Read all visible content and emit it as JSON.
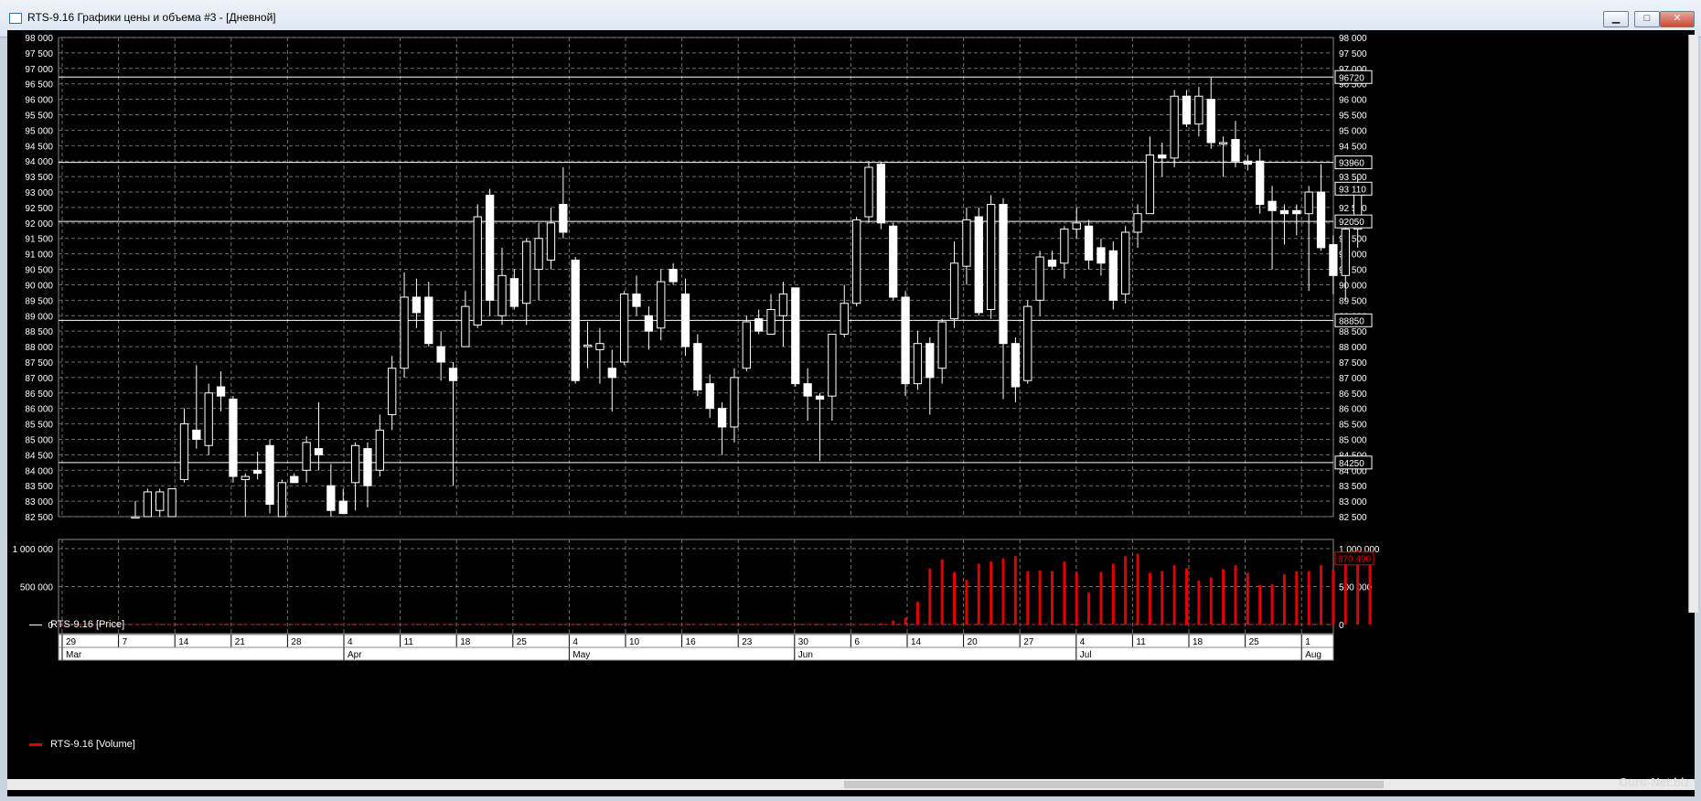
{
  "window": {
    "title": "RTS-9.16 Графики цены и объема #3 - [Дневной]",
    "minimize": "▁",
    "maximize": "□",
    "close": "✕"
  },
  "colors": {
    "background": "#000000",
    "grid": "#6f6f6f",
    "axis_text": "#ffffff",
    "volume_bar": "#e00000",
    "level_line": "#ffffff"
  },
  "price_panel": {
    "legend": "RTS-9.16 [Price]",
    "y_ticks": [
      "98 000",
      "97 500",
      "97 000",
      "96 500",
      "96 000",
      "95 500",
      "95 000",
      "94 500",
      "94 000",
      "93 500",
      "93 000",
      "92 500",
      "92 000",
      "91 500",
      "91 000",
      "90 500",
      "90 000",
      "89 500",
      "89 000",
      "88 500",
      "88 000",
      "87 500",
      "87 000",
      "86 500",
      "86 000",
      "85 500",
      "85 000",
      "84 500",
      "84 000",
      "83 500",
      "83 000",
      "82 500"
    ],
    "level_labels": [
      "96720",
      "93960",
      "93 110",
      "92050",
      "88850",
      "84250"
    ]
  },
  "volume_panel": {
    "legend": "RTS-9.16 [Volume]",
    "y_ticks": [
      "1 000 000",
      "500 000",
      "0"
    ],
    "last_label": "870 490"
  },
  "time_axis": {
    "days": [
      "29",
      "7",
      "14",
      "21",
      "28",
      "4",
      "11",
      "18",
      "25",
      "4",
      "10",
      "16",
      "23",
      "30",
      "6",
      "14",
      "20",
      "27",
      "4",
      "11",
      "18",
      "25",
      "1"
    ],
    "months": [
      "Mar",
      "Apr",
      "May",
      "Jun",
      "Jul",
      "Aug"
    ]
  },
  "watermark": "Guru-Net.biz",
  "chart_data": {
    "type": "candlestick",
    "ylim": [
      82500,
      98000
    ],
    "levels": [
      96720,
      93960,
      92050,
      88850,
      84250
    ],
    "last_price": 93110,
    "candles": [
      {
        "o": 82500,
        "h": 83000,
        "l": 82500,
        "c": 82500
      },
      {
        "o": 82500,
        "h": 83400,
        "l": 82500,
        "c": 83300
      },
      {
        "o": 82700,
        "h": 83400,
        "l": 82500,
        "c": 83300
      },
      {
        "o": 82500,
        "h": 83400,
        "l": 82500,
        "c": 83400
      },
      {
        "o": 83700,
        "h": 86000,
        "l": 83600,
        "c": 85500
      },
      {
        "o": 85300,
        "h": 87400,
        "l": 84700,
        "c": 85000
      },
      {
        "o": 84800,
        "h": 86800,
        "l": 84500,
        "c": 86500
      },
      {
        "o": 86700,
        "h": 87200,
        "l": 85900,
        "c": 86400
      },
      {
        "o": 86300,
        "h": 86400,
        "l": 83600,
        "c": 83800
      },
      {
        "o": 83700,
        "h": 83900,
        "l": 82500,
        "c": 83800
      },
      {
        "o": 84000,
        "h": 84600,
        "l": 83700,
        "c": 83900
      },
      {
        "o": 84800,
        "h": 85000,
        "l": 82600,
        "c": 82900
      },
      {
        "o": 82500,
        "h": 83700,
        "l": 82500,
        "c": 83600
      },
      {
        "o": 83800,
        "h": 83900,
        "l": 83600,
        "c": 83600
      },
      {
        "o": 84000,
        "h": 85100,
        "l": 83600,
        "c": 84900
      },
      {
        "o": 84700,
        "h": 86200,
        "l": 84000,
        "c": 84500
      },
      {
        "o": 83500,
        "h": 84200,
        "l": 82500,
        "c": 82700
      },
      {
        "o": 83000,
        "h": 83400,
        "l": 82600,
        "c": 82600
      },
      {
        "o": 83600,
        "h": 84900,
        "l": 82700,
        "c": 84800
      },
      {
        "o": 84700,
        "h": 84900,
        "l": 82800,
        "c": 83500
      },
      {
        "o": 84000,
        "h": 85800,
        "l": 83800,
        "c": 85300
      },
      {
        "o": 85800,
        "h": 87700,
        "l": 85300,
        "c": 87300
      },
      {
        "o": 87300,
        "h": 90400,
        "l": 87000,
        "c": 89600
      },
      {
        "o": 89600,
        "h": 90200,
        "l": 88600,
        "c": 89100
      },
      {
        "o": 89600,
        "h": 90100,
        "l": 88000,
        "c": 88100
      },
      {
        "o": 88000,
        "h": 88500,
        "l": 86900,
        "c": 87500
      },
      {
        "o": 87300,
        "h": 87500,
        "l": 83500,
        "c": 86900
      },
      {
        "o": 88000,
        "h": 89800,
        "l": 88000,
        "c": 89300
      },
      {
        "o": 88700,
        "h": 92600,
        "l": 88600,
        "c": 92200
      },
      {
        "o": 92900,
        "h": 93100,
        "l": 89000,
        "c": 89500
      },
      {
        "o": 89000,
        "h": 91200,
        "l": 88700,
        "c": 90300
      },
      {
        "o": 90200,
        "h": 90500,
        "l": 89200,
        "c": 89300
      },
      {
        "o": 89400,
        "h": 91500,
        "l": 88700,
        "c": 91400
      },
      {
        "o": 90500,
        "h": 92000,
        "l": 89500,
        "c": 91500
      },
      {
        "o": 90800,
        "h": 92500,
        "l": 90500,
        "c": 92000
      },
      {
        "o": 92600,
        "h": 93800,
        "l": 91500,
        "c": 91700
      },
      {
        "o": 90800,
        "h": 90900,
        "l": 86800,
        "c": 86900
      },
      {
        "o": 88000,
        "h": 88800,
        "l": 87300,
        "c": 88050
      },
      {
        "o": 87900,
        "h": 88600,
        "l": 86800,
        "c": 88100
      },
      {
        "o": 87300,
        "h": 87900,
        "l": 85900,
        "c": 87000
      },
      {
        "o": 87500,
        "h": 89800,
        "l": 87400,
        "c": 89700
      },
      {
        "o": 89700,
        "h": 90300,
        "l": 89000,
        "c": 89300
      },
      {
        "o": 89000,
        "h": 89300,
        "l": 87900,
        "c": 88500
      },
      {
        "o": 88600,
        "h": 90500,
        "l": 88200,
        "c": 90100
      },
      {
        "o": 90500,
        "h": 90700,
        "l": 90000,
        "c": 90100
      },
      {
        "o": 89700,
        "h": 90200,
        "l": 87700,
        "c": 88000
      },
      {
        "o": 88100,
        "h": 88400,
        "l": 86400,
        "c": 86600
      },
      {
        "o": 86800,
        "h": 87100,
        "l": 85700,
        "c": 86000
      },
      {
        "o": 86000,
        "h": 86200,
        "l": 84500,
        "c": 85400
      },
      {
        "o": 85400,
        "h": 87300,
        "l": 84900,
        "c": 87000
      },
      {
        "o": 87300,
        "h": 89000,
        "l": 87200,
        "c": 88800
      },
      {
        "o": 88900,
        "h": 89200,
        "l": 88400,
        "c": 88500
      },
      {
        "o": 88400,
        "h": 89700,
        "l": 88400,
        "c": 89200
      },
      {
        "o": 89000,
        "h": 90100,
        "l": 88000,
        "c": 89700
      },
      {
        "o": 89900,
        "h": 89900,
        "l": 86700,
        "c": 86800
      },
      {
        "o": 86800,
        "h": 87300,
        "l": 85600,
        "c": 86400
      },
      {
        "o": 86400,
        "h": 86500,
        "l": 84300,
        "c": 86300
      },
      {
        "o": 86400,
        "h": 88300,
        "l": 85600,
        "c": 88400
      },
      {
        "o": 88400,
        "h": 90000,
        "l": 88300,
        "c": 89400
      },
      {
        "o": 89400,
        "h": 92200,
        "l": 89300,
        "c": 92100
      },
      {
        "o": 92200,
        "h": 94000,
        "l": 92000,
        "c": 93800
      },
      {
        "o": 93900,
        "h": 93950,
        "l": 91800,
        "c": 92000
      },
      {
        "o": 91900,
        "h": 92000,
        "l": 89500,
        "c": 89600
      },
      {
        "o": 89600,
        "h": 89800,
        "l": 86400,
        "c": 86800
      },
      {
        "o": 86800,
        "h": 88500,
        "l": 86600,
        "c": 88100
      },
      {
        "o": 88100,
        "h": 88300,
        "l": 85800,
        "c": 87000
      },
      {
        "o": 87300,
        "h": 88900,
        "l": 86800,
        "c": 88800
      },
      {
        "o": 88900,
        "h": 91400,
        "l": 88600,
        "c": 90700
      },
      {
        "o": 90600,
        "h": 92500,
        "l": 90000,
        "c": 92100
      },
      {
        "o": 92200,
        "h": 92500,
        "l": 89000,
        "c": 89100
      },
      {
        "o": 89200,
        "h": 92900,
        "l": 88900,
        "c": 92600
      },
      {
        "o": 92600,
        "h": 92800,
        "l": 86300,
        "c": 88100
      },
      {
        "o": 88100,
        "h": 88300,
        "l": 86200,
        "c": 86700
      },
      {
        "o": 86900,
        "h": 89500,
        "l": 86800,
        "c": 89300
      },
      {
        "o": 89500,
        "h": 91100,
        "l": 89000,
        "c": 90900
      },
      {
        "o": 90800,
        "h": 91100,
        "l": 90500,
        "c": 90600
      },
      {
        "o": 90700,
        "h": 91900,
        "l": 90200,
        "c": 91800
      },
      {
        "o": 91800,
        "h": 92500,
        "l": 91500,
        "c": 92000
      },
      {
        "o": 91900,
        "h": 92100,
        "l": 90500,
        "c": 90800
      },
      {
        "o": 91200,
        "h": 91500,
        "l": 90300,
        "c": 90700
      },
      {
        "o": 91100,
        "h": 91400,
        "l": 89200,
        "c": 89500
      },
      {
        "o": 89700,
        "h": 91900,
        "l": 89400,
        "c": 91700
      },
      {
        "o": 91700,
        "h": 92600,
        "l": 91200,
        "c": 92300
      },
      {
        "o": 92300,
        "h": 94800,
        "l": 92300,
        "c": 94200
      },
      {
        "o": 94200,
        "h": 94600,
        "l": 93500,
        "c": 94100
      },
      {
        "o": 94100,
        "h": 96300,
        "l": 93800,
        "c": 96100
      },
      {
        "o": 96100,
        "h": 96300,
        "l": 95100,
        "c": 95200
      },
      {
        "o": 95200,
        "h": 96400,
        "l": 94800,
        "c": 96100
      },
      {
        "o": 96000,
        "h": 96700,
        "l": 94400,
        "c": 94600
      },
      {
        "o": 94600,
        "h": 94800,
        "l": 93500,
        "c": 94600
      },
      {
        "o": 94700,
        "h": 95300,
        "l": 93800,
        "c": 94000
      },
      {
        "o": 94000,
        "h": 94200,
        "l": 93700,
        "c": 93900
      },
      {
        "o": 94000,
        "h": 94400,
        "l": 92300,
        "c": 92600
      },
      {
        "o": 92700,
        "h": 93200,
        "l": 90500,
        "c": 92400
      },
      {
        "o": 92400,
        "h": 92600,
        "l": 91300,
        "c": 92300
      },
      {
        "o": 92400,
        "h": 92600,
        "l": 91600,
        "c": 92300
      },
      {
        "o": 92300,
        "h": 93200,
        "l": 89800,
        "c": 93000
      },
      {
        "o": 93000,
        "h": 93900,
        "l": 91100,
        "c": 91200
      },
      {
        "o": 91300,
        "h": 91600,
        "l": 89700,
        "c": 90300
      },
      {
        "o": 90300,
        "h": 92000,
        "l": 89500,
        "c": 91800
      },
      {
        "o": 91800,
        "h": 93500,
        "l": 91200,
        "c": 93100
      }
    ],
    "volume": [
      0,
      0,
      0,
      0,
      0,
      0,
      0,
      0,
      0,
      0,
      0,
      0,
      0,
      0,
      0,
      0,
      0,
      0,
      0,
      0,
      0,
      0,
      0,
      0,
      0,
      0,
      0,
      0,
      0,
      0,
      0,
      0,
      0,
      0,
      0,
      0,
      0,
      0,
      0,
      0,
      0,
      0,
      0,
      0,
      0,
      0,
      0,
      0,
      0,
      0,
      0,
      0,
      0,
      0,
      0,
      0,
      0,
      0,
      2000,
      5000,
      9000,
      15000,
      50000,
      90000,
      300000,
      740000,
      860000,
      690000,
      590000,
      800000,
      830000,
      870000,
      900000,
      700000,
      710000,
      700000,
      830000,
      690000,
      420000,
      690000,
      800000,
      900000,
      930000,
      680000,
      700000,
      780000,
      740000,
      580000,
      620000,
      730000,
      780000,
      680000,
      520000,
      530000,
      660000,
      700000,
      700000,
      780000,
      720000,
      800000,
      980000,
      870490
    ]
  }
}
